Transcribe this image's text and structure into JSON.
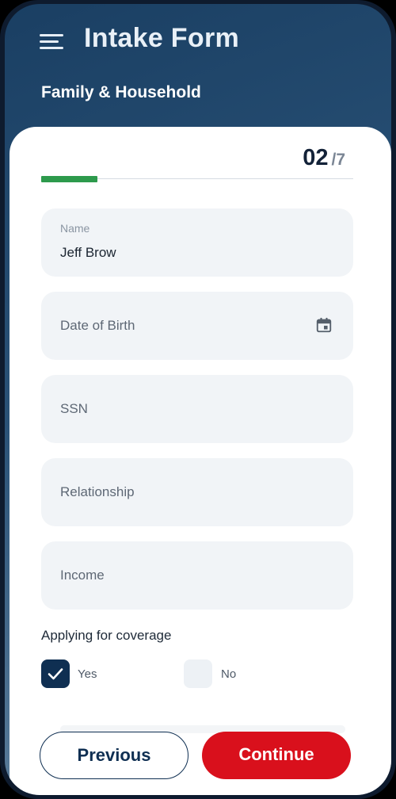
{
  "header": {
    "title": "Intake Form",
    "section": "Family & Household"
  },
  "progress": {
    "current": "02",
    "total": "/7",
    "fraction": 0.18
  },
  "fields": {
    "name": {
      "label": "Name",
      "value": "Jeff Brow"
    },
    "dob": {
      "placeholder": "Date of Birth"
    },
    "ssn": {
      "placeholder": "SSN"
    },
    "relationship": {
      "placeholder": "Relationship"
    },
    "income": {
      "placeholder": "Income"
    }
  },
  "coverage": {
    "label": "Applying for coverage",
    "yes": "Yes",
    "no": "No",
    "selected": "Yes"
  },
  "actions": {
    "previous": "Previous",
    "continue": "Continue"
  },
  "colors": {
    "primary": "#0f2f52",
    "accent": "#d9101c",
    "progress": "#2d9a4c"
  },
  "icons": [
    "menu-icon",
    "calendar-icon",
    "checkmark-icon"
  ]
}
